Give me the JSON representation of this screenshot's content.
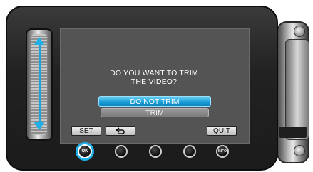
{
  "dialog": {
    "message": "DO YOU WANT TO TRIM\nTHE VIDEO?",
    "options": [
      "DO NOT TRIM",
      "TRIM"
    ],
    "selected_option": "DO NOT TRIM"
  },
  "soft_buttons": {
    "set_label": "SET",
    "back_icon": "return-arrow-icon",
    "quit_label": "QUIT"
  },
  "hardware_buttons": {
    "ok_label": "OK",
    "info_label": "INFO"
  },
  "colors": {
    "highlight": "#1aa0d8",
    "screen_bg": "#545454",
    "option_inactive": "#7c7c7c"
  }
}
